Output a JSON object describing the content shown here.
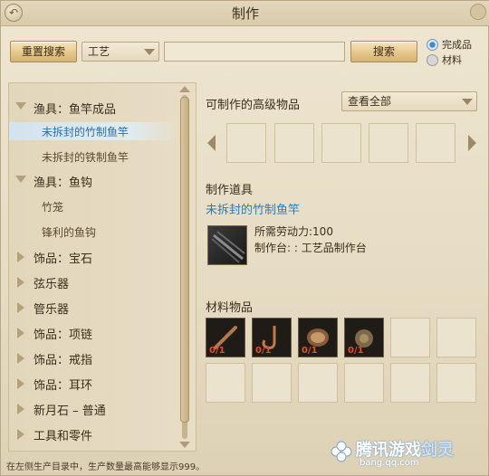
{
  "window": {
    "title": "制作"
  },
  "toolbar": {
    "reset_label": "重置搜索",
    "category_value": "工艺",
    "search_value": "",
    "search_label": "搜索",
    "radio_finished": "完成品",
    "radio_material": "材料",
    "radio_selected": "finished"
  },
  "tree": {
    "groups": [
      {
        "label": "渔具：鱼竿成品",
        "expanded": true,
        "children": [
          "未拆封的竹制鱼竿",
          "未拆封的铁制鱼竿"
        ]
      },
      {
        "label": "渔具：鱼钩",
        "expanded": true,
        "children": [
          "竹笼",
          "锋利的鱼钩"
        ]
      },
      {
        "label": "饰品：宝石",
        "expanded": false
      },
      {
        "label": "弦乐器",
        "expanded": false
      },
      {
        "label": "管乐器",
        "expanded": false
      },
      {
        "label": "饰品：项链",
        "expanded": false
      },
      {
        "label": "饰品：戒指",
        "expanded": false
      },
      {
        "label": "饰品：耳环",
        "expanded": false
      },
      {
        "label": "新月石 – 普通",
        "expanded": false
      },
      {
        "label": "工具和零件",
        "expanded": false
      }
    ],
    "selected": "未拆封的竹制鱼竿"
  },
  "advanced": {
    "title": "可制作的高级物品",
    "filter_value": "查看全部",
    "slots": 5
  },
  "tool": {
    "title": "制作道具",
    "name": "未拆封的竹制鱼竿",
    "labor": "所需劳动力:100",
    "station": "制作台: : 工艺品制作台"
  },
  "materials": {
    "title": "材料物品",
    "items": [
      {
        "qty": "0/1",
        "icon": "stick-icon"
      },
      {
        "qty": "0/1",
        "icon": "hook-icon"
      },
      {
        "qty": "0/1",
        "icon": "spool-icon"
      },
      {
        "qty": "0/1",
        "icon": "bell-icon"
      }
    ],
    "total_slots": 12
  },
  "footer": {
    "note": "在左侧生产目录中，生产数量最高能够显示999。"
  },
  "watermark": {
    "text": "腾讯游戏",
    "brand": "剑灵",
    "url": "bang.qq.com"
  },
  "colors": {
    "accent_blue": "#2f7bb8",
    "button_gold": "#e6c88d",
    "qty_red": "#e84b2a"
  }
}
